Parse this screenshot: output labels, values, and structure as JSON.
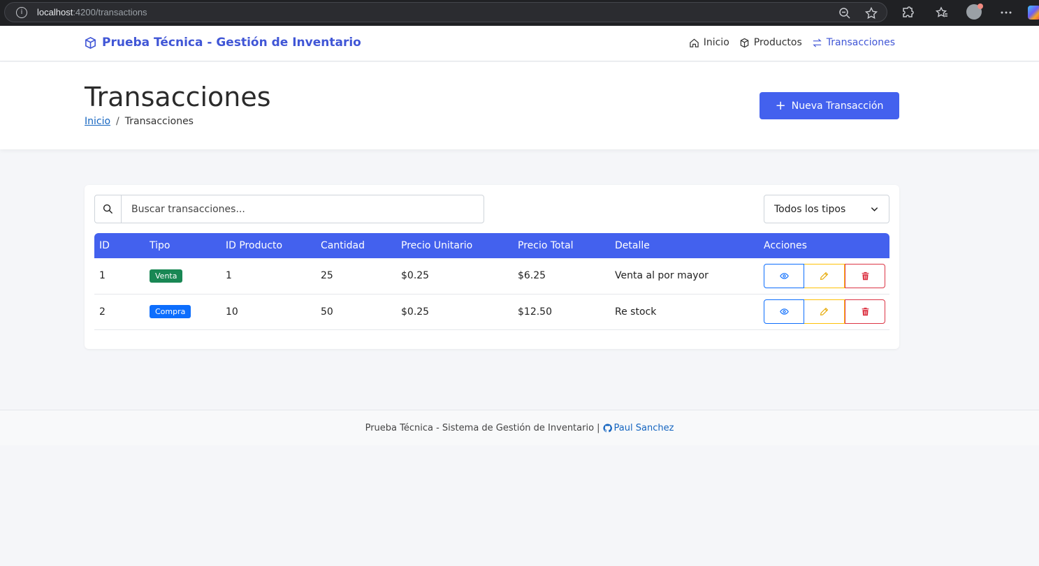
{
  "browser": {
    "url_host": "localhost",
    "url_path": ":4200/transactions"
  },
  "navbar": {
    "brand": "Prueba Técnica - Gestión de Inventario",
    "links": [
      {
        "label": "Inicio",
        "icon": "home-icon"
      },
      {
        "label": "Productos",
        "icon": "box-icon"
      },
      {
        "label": "Transacciones",
        "icon": "swap-icon",
        "active": true
      }
    ]
  },
  "header": {
    "title": "Transacciones",
    "breadcrumb": {
      "home": "Inicio",
      "sep": "/",
      "current": "Transacciones"
    },
    "new_button": "Nueva Transacción"
  },
  "filters": {
    "search_placeholder": "Buscar transacciones...",
    "type_select": "Todos los tipos"
  },
  "table": {
    "columns": [
      "ID",
      "Tipo",
      "ID Producto",
      "Cantidad",
      "Precio Unitario",
      "Precio Total",
      "Detalle",
      "Acciones"
    ],
    "rows": [
      {
        "id": "1",
        "tipo": "Venta",
        "id_producto": "1",
        "cantidad": "25",
        "precio_unitario": "$0.25",
        "precio_total": "$6.25",
        "detalle": "Venta al por mayor"
      },
      {
        "id": "2",
        "tipo": "Compra",
        "id_producto": "10",
        "cantidad": "50",
        "precio_unitario": "$0.25",
        "precio_total": "$12.50",
        "detalle": "Re stock"
      }
    ]
  },
  "footer": {
    "text": "Prueba Técnica - Sistema de Gestión de Inventario |",
    "author": "Paul Sanchez"
  },
  "colors": {
    "primary": "#4361ee",
    "brand": "#4056d6",
    "venta": "#198754",
    "compra": "#0d6efd",
    "danger": "#dc3545",
    "warning": "#ffc107"
  }
}
